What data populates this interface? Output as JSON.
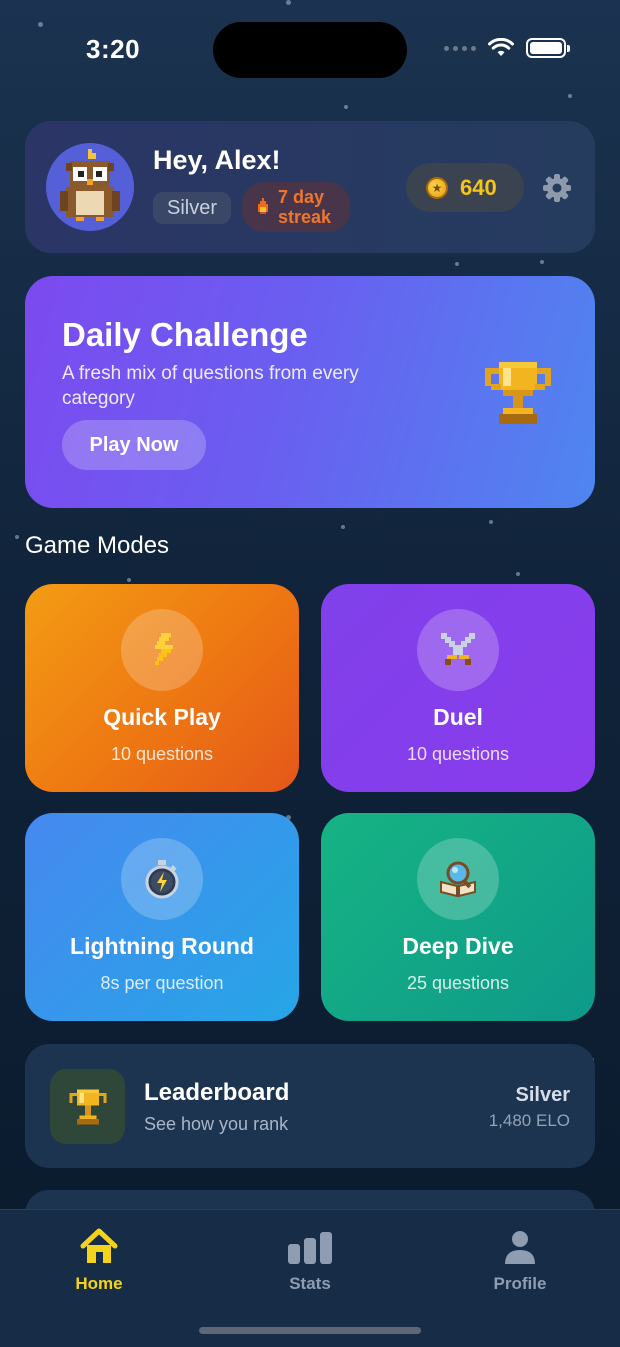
{
  "status_bar": {
    "time": "3:20"
  },
  "header": {
    "greeting": "Hey, Alex!",
    "rank": "Silver",
    "streak": "7 day\nstreak",
    "coins": "640"
  },
  "daily_challenge": {
    "title": "Daily Challenge",
    "subtitle": "A fresh mix of questions from every category",
    "button": "Play Now"
  },
  "game_modes": {
    "section_title": "Game Modes",
    "modes": [
      {
        "title": "Quick Play",
        "subtitle": "10 questions",
        "icon": "lightning-icon"
      },
      {
        "title": "Duel",
        "subtitle": "10 questions",
        "icon": "crossed-swords-icon"
      },
      {
        "title": "Lightning Round",
        "subtitle": "8s per question",
        "icon": "stopwatch-icon"
      },
      {
        "title": "Deep Dive",
        "subtitle": "25 questions",
        "icon": "book-magnifier-icon"
      }
    ]
  },
  "leaderboard": {
    "title": "Leaderboard",
    "subtitle": "See how you rank",
    "rank": "Silver",
    "elo": "1,480 ELO"
  },
  "tab_bar": {
    "tabs": [
      {
        "label": "Home",
        "icon": "home-icon",
        "active": true
      },
      {
        "label": "Stats",
        "icon": "bar-chart-icon",
        "active": false
      },
      {
        "label": "Profile",
        "icon": "person-icon",
        "active": false
      }
    ]
  },
  "colors": {
    "accent_yellow": "#f5d31a",
    "streak_orange": "#f0762a",
    "daily_gradient_start": "#7c4af0",
    "daily_gradient_end": "#4f86f0"
  }
}
